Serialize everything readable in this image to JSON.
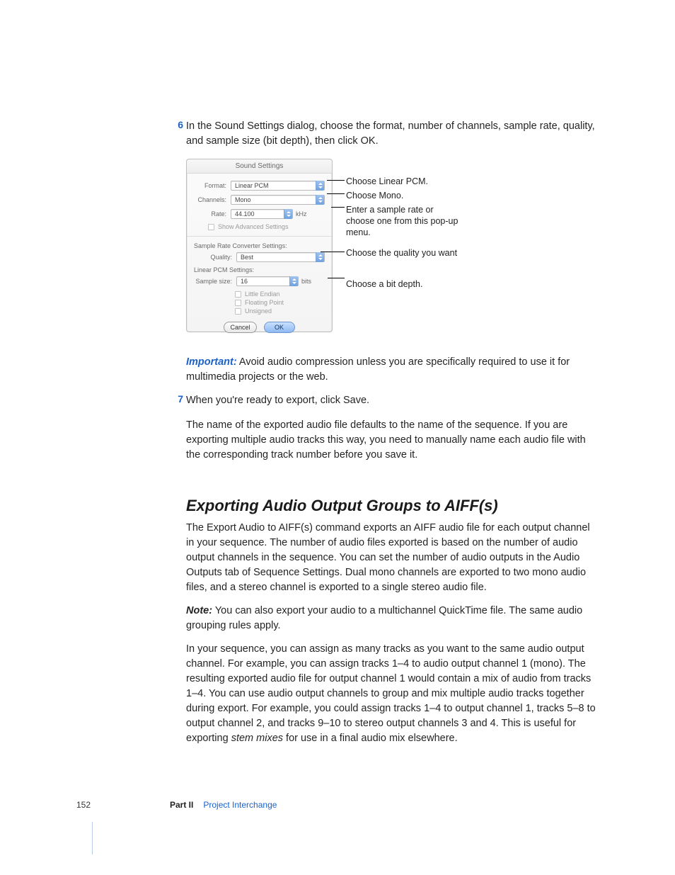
{
  "steps": {
    "s6_num": "6",
    "s6_text": "In the Sound Settings dialog, choose the format, number of channels, sample rate, quality, and sample size (bit depth), then click OK.",
    "s7_num": "7",
    "s7_text": "When you're ready to export, click Save."
  },
  "dialog": {
    "title": "Sound Settings",
    "format_label": "Format:",
    "format_value": "Linear PCM",
    "channels_label": "Channels:",
    "channels_value": "Mono",
    "rate_label": "Rate:",
    "rate_value": "44.100",
    "rate_unit": "kHz",
    "show_advanced": "Show Advanced Settings",
    "srcs_label": "Sample Rate Converter Settings:",
    "quality_label": "Quality:",
    "quality_value": "Best",
    "lpcm_label": "Linear PCM Settings:",
    "sample_size_label": "Sample size:",
    "sample_size_value": "16",
    "sample_size_unit": "bits",
    "little_endian": "Little Endian",
    "floating_point": "Floating Point",
    "unsigned": "Unsigned",
    "cancel": "Cancel",
    "ok": "OK"
  },
  "callouts": {
    "c1": "Choose Linear PCM.",
    "c2": "Choose Mono.",
    "c3": "Enter a sample rate or choose one from this pop-up menu.",
    "c4": "Choose the quality you want",
    "c5": "Choose a bit depth."
  },
  "important_label": "Important:",
  "important_text": "  Avoid audio compression unless you are specifically required to use it for multimedia projects or the web.",
  "post_s7": "The name of the exported audio file defaults to the name of the sequence. If you are exporting multiple audio tracks this way, you need to manually name each audio file with the corresponding track number before you save it.",
  "h2": "Exporting Audio Output Groups to AIFF(s)",
  "p1": "The Export Audio to AIFF(s) command exports an AIFF audio file for each output channel in your sequence. The number of audio files exported is based on the number of audio output channels in the sequence. You can set the number of audio outputs in the Audio Outputs tab of Sequence Settings. Dual mono channels are exported to two mono audio files, and a stereo channel is exported to a single stereo audio file.",
  "note_label": "Note:",
  "note_text": "  You can also export your audio to a multichannel QuickTime file. The same audio grouping rules apply.",
  "p2a": "In your sequence, you can assign as many tracks as you want to the same audio output channel. For example, you can assign tracks 1–4 to audio output channel 1 (mono). The resulting exported audio file for output channel 1 would contain a mix of audio from tracks 1–4. You can use audio output channels to group and mix multiple audio tracks together during export. For example, you could assign tracks 1–4 to output channel 1, tracks 5–8 to output channel 2, and tracks 9–10 to stereo output channels 3 and 4. This is useful for exporting ",
  "p2_em": "stem mixes",
  "p2b": " for use in a final audio mix elsewhere.",
  "footer": {
    "page": "152",
    "part": "Part II",
    "chapter": "Project Interchange"
  }
}
